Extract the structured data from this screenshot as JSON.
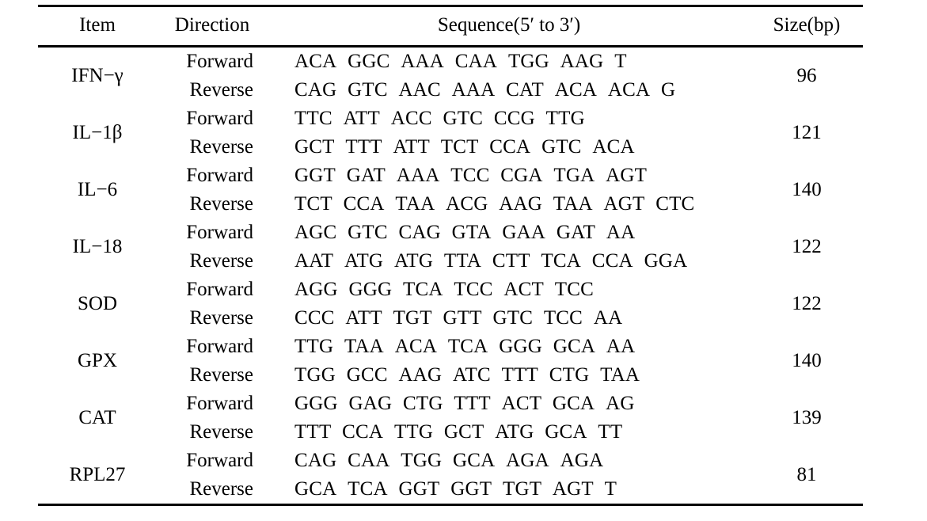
{
  "table": {
    "columns": [
      {
        "key": "item",
        "label": "Item"
      },
      {
        "key": "direction",
        "label": "Direction"
      },
      {
        "key": "sequence",
        "label": "Sequence(5′ to 3′)"
      },
      {
        "key": "size",
        "label": "Size(bp)"
      }
    ],
    "direction_labels": {
      "forward": "Forward",
      "reverse": "Reverse"
    },
    "rows": [
      {
        "item": "IFN−γ",
        "size": "96",
        "forward": "ACA GGC AAA CAA TGG AAG T",
        "reverse": "CAG GTC AAC AAA CAT ACA ACA G"
      },
      {
        "item": "IL−1β",
        "size": "121",
        "forward": "TTC ATT ACC GTC CCG TTG",
        "reverse": "GCT TTT ATT TCT CCA GTC ACA"
      },
      {
        "item": "IL−6",
        "size": "140",
        "forward": "GGT GAT AAA TCC CGA TGA AGT",
        "reverse": "TCT CCA TAA ACG AAG TAA AGT CTC"
      },
      {
        "item": "IL−18",
        "size": "122",
        "forward": "AGC GTC CAG GTA GAA GAT AA",
        "reverse": "AAT ATG ATG TTA CTT TCA CCA GGA"
      },
      {
        "item": "SOD",
        "size": "122",
        "forward": "AGG GGG TCA TCC ACT TCC",
        "reverse": "CCC ATT TGT GTT GTC TCC AA"
      },
      {
        "item": "GPX",
        "size": "140",
        "forward": "TTG TAA ACA TCA GGG GCA AA",
        "reverse": "TGG GCC AAG ATC TTT CTG TAA"
      },
      {
        "item": "CAT",
        "size": "139",
        "forward": "GGG GAG CTG TTT ACT GCA AG",
        "reverse": "TTT CCA TTG GCT ATG GCA TT"
      },
      {
        "item": "RPL27",
        "size": "81",
        "forward": "CAG CAA TGG GCA AGA AGA",
        "reverse": "GCA TCA GGT GGT TGT AGT T"
      }
    ]
  }
}
